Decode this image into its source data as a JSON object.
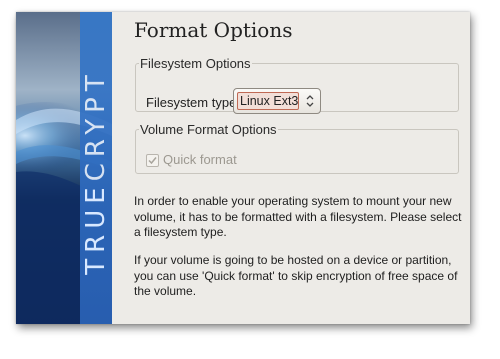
{
  "app": {
    "brand_part1": "TRUE",
    "brand_part2": "CRYPT"
  },
  "page": {
    "title": "Format Options"
  },
  "filesystem_options": {
    "legend": "Filesystem Options",
    "type_label": "Filesystem type:",
    "selected_value": "Linux Ext3"
  },
  "volume_format_options": {
    "legend": "Volume Format Options",
    "quick_format_label": "Quick format",
    "quick_format_checked": true,
    "quick_format_enabled": false
  },
  "info": {
    "paragraph1": "In order to enable your operating system to mount your new volume, it has to be formatted with a filesystem. Please select a filesystem type.",
    "paragraph2": "If your volume is going to be hosted on a device or partition, you can use 'Quick format' to skip encryption of free space of the volume."
  },
  "colors": {
    "window_bg": "#edebe7",
    "banner_blue": "#2f6cc0",
    "select_focus": "#c06a55"
  }
}
